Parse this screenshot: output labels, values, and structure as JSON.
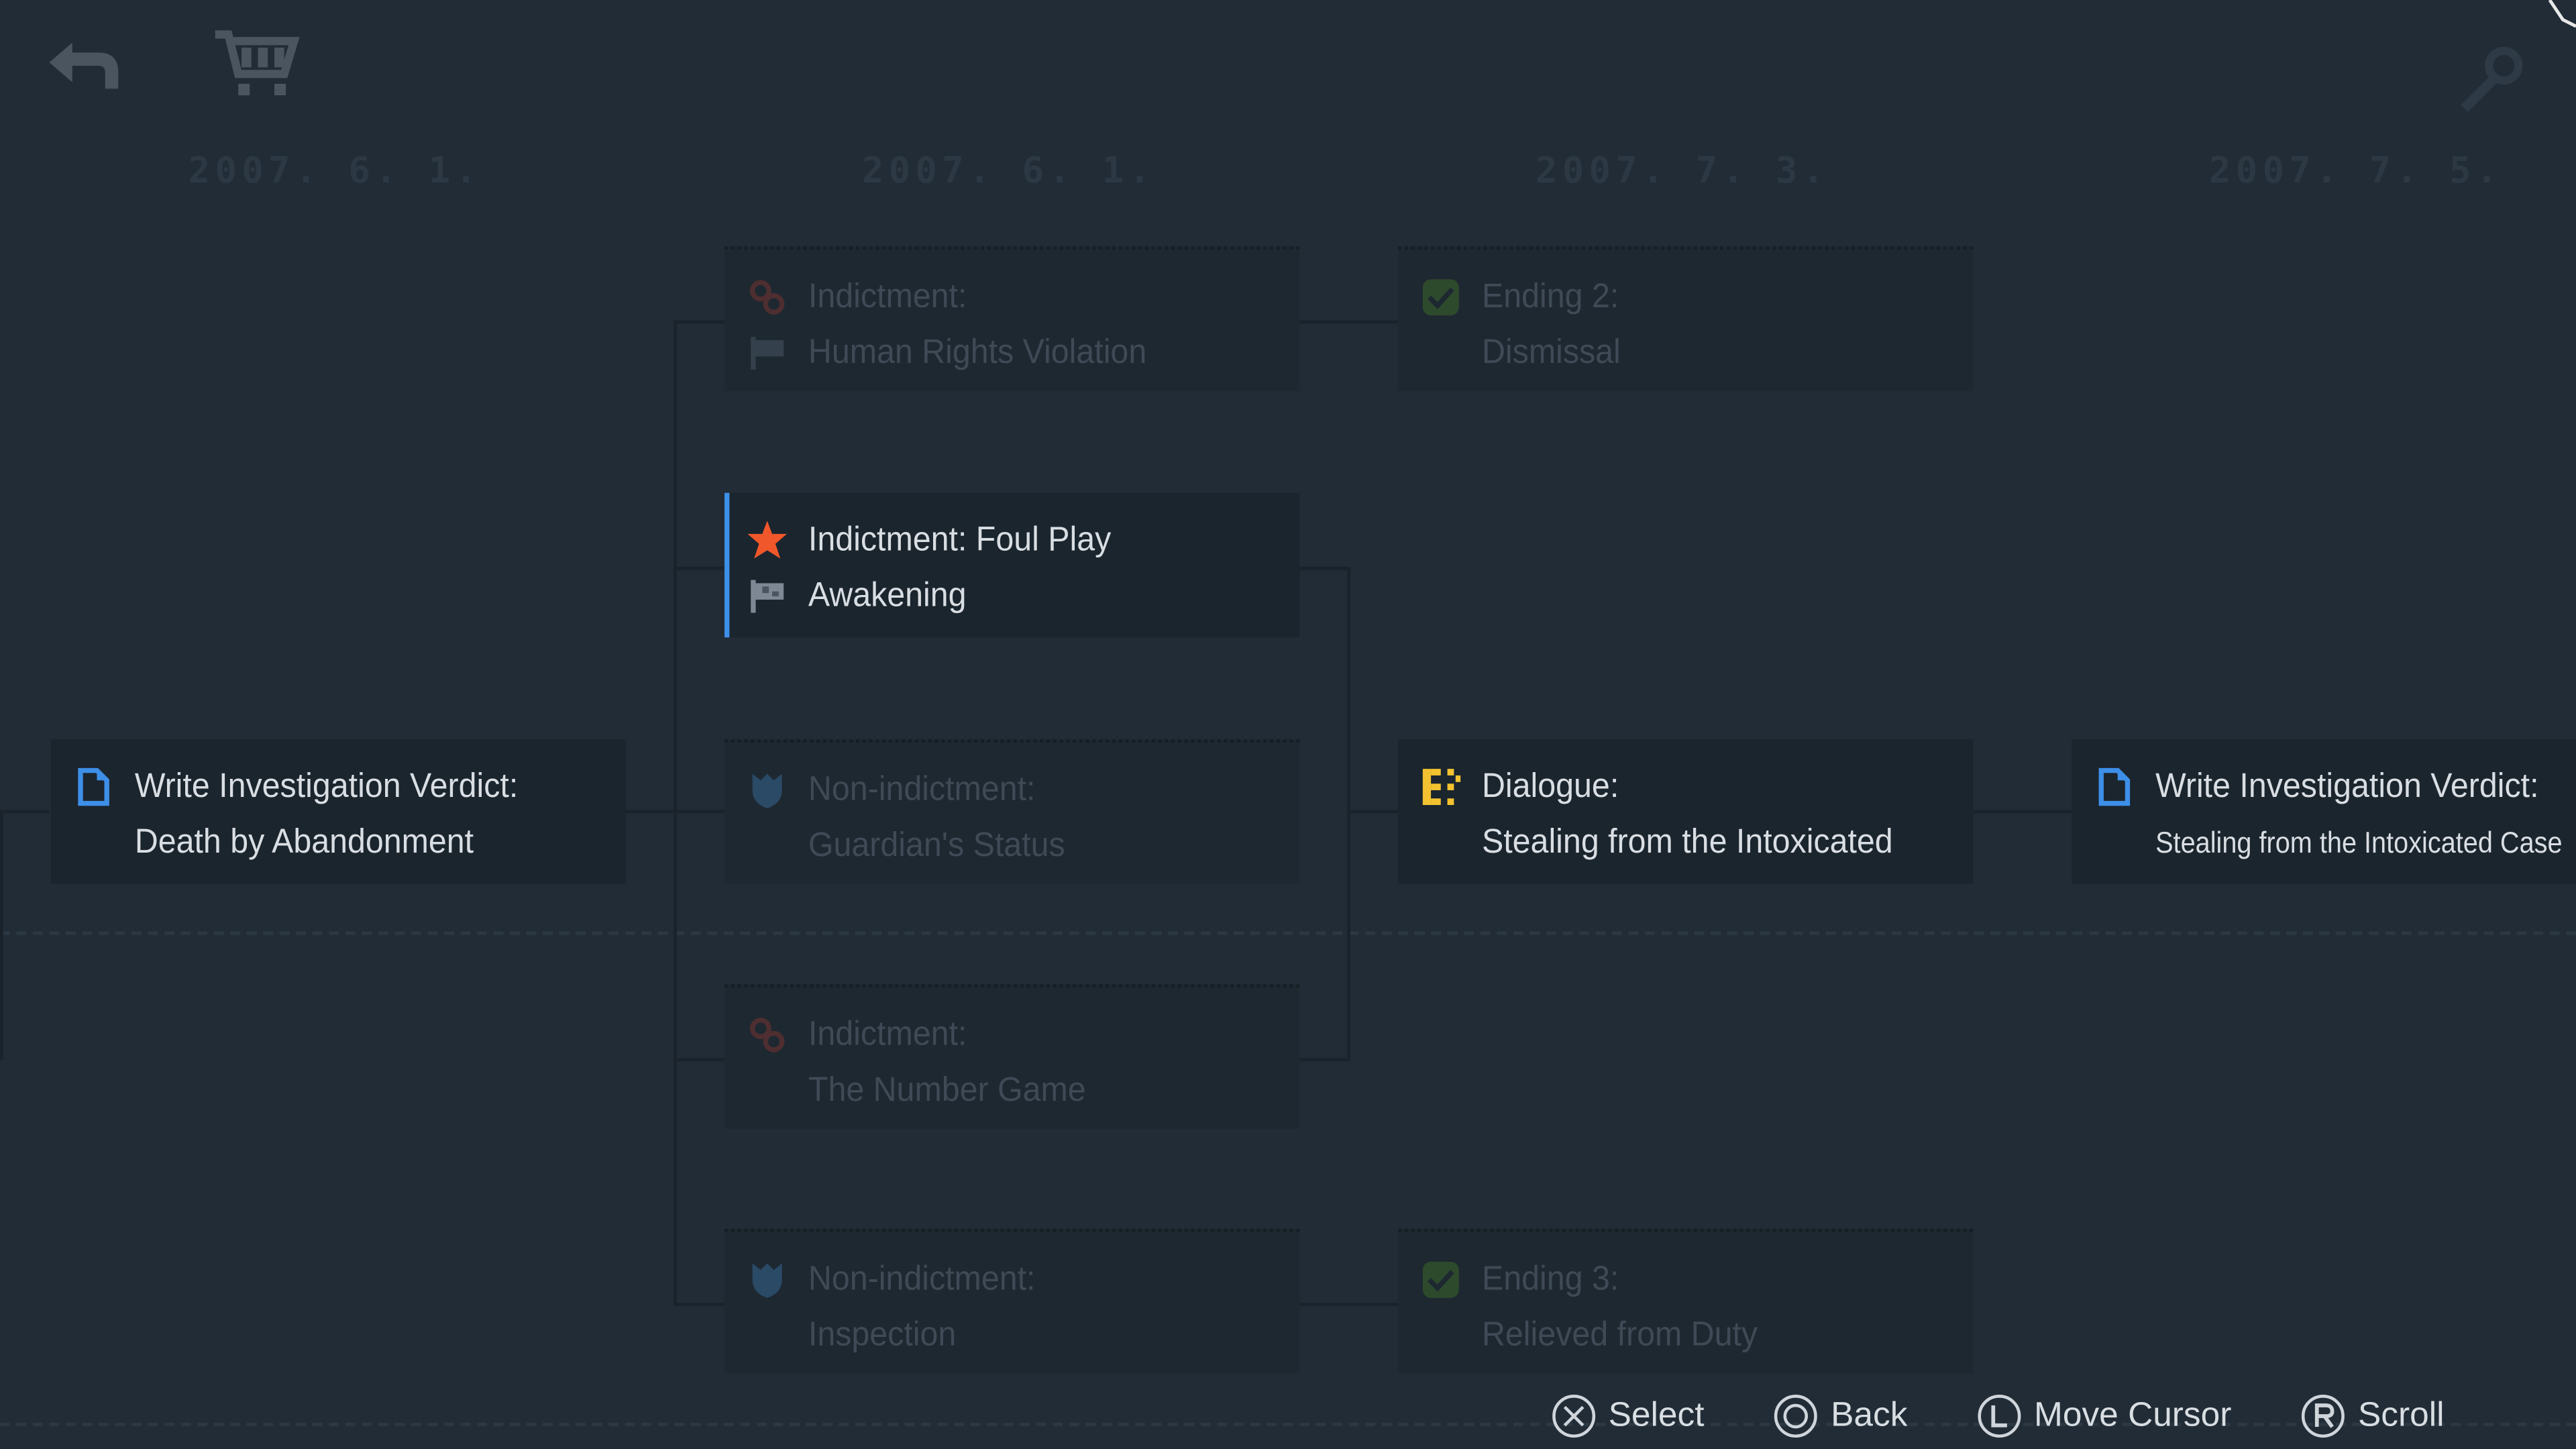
{
  "toolbar": {
    "back_icon": "back-arrow-icon",
    "shop_icon": "shopping-cart-icon",
    "tool_icon": "wrench-icon"
  },
  "dates": [
    "2007. 6. 1.",
    "2007. 6. 1.",
    "2007. 7. 3.",
    "2007. 7. 5."
  ],
  "nodes": {
    "verdict_abandonment": {
      "icon": "document-icon",
      "line1": "Write Investigation Verdict:",
      "line2": "Death by Abandonment"
    },
    "human_rights": {
      "icon": "handcuffs-icon",
      "icon2": "flag-icon",
      "line1": "Indictment:",
      "line2": "Human Rights Violation"
    },
    "foul_play": {
      "icon": "star-icon",
      "icon2": "flag-icon",
      "line1": "Indictment: Foul Play",
      "line2": "Awakening"
    },
    "guardians_status": {
      "icon": "shield-icon",
      "line1": "Non-indictment:",
      "line2": "Guardian's Status"
    },
    "number_game": {
      "icon": "handcuffs-icon",
      "line1": "Indictment:",
      "line2": "The Number Game"
    },
    "inspection": {
      "icon": "shield-icon",
      "line1": "Non-indictment:",
      "line2": "Inspection"
    },
    "ending2": {
      "icon": "checkmark-icon",
      "line1": "Ending 2:",
      "line2": "Dismissal"
    },
    "dialogue": {
      "icon": "dialogue-icon",
      "line1": "Dialogue:",
      "line2": "Stealing from the Intoxicated"
    },
    "ending3": {
      "icon": "checkmark-icon",
      "line1": "Ending 3:",
      "line2": "Relieved from Duty"
    },
    "verdict_intoxicated": {
      "icon": "document-icon",
      "line1": "Write Investigation Verdict:",
      "line2": "Stealing from the Intoxicated Case"
    }
  },
  "controls": {
    "select": "Select",
    "back": "Back",
    "move_cursor": "Move Cursor",
    "scroll": "Scroll"
  },
  "colors": {
    "background": "#212c36",
    "card": "#1b252e",
    "selected_accent": "#3d8fe8",
    "star": "#f0572a",
    "dialogue": "#f2c230",
    "document": "#3d8fe8",
    "check": "#3d6b3a"
  }
}
